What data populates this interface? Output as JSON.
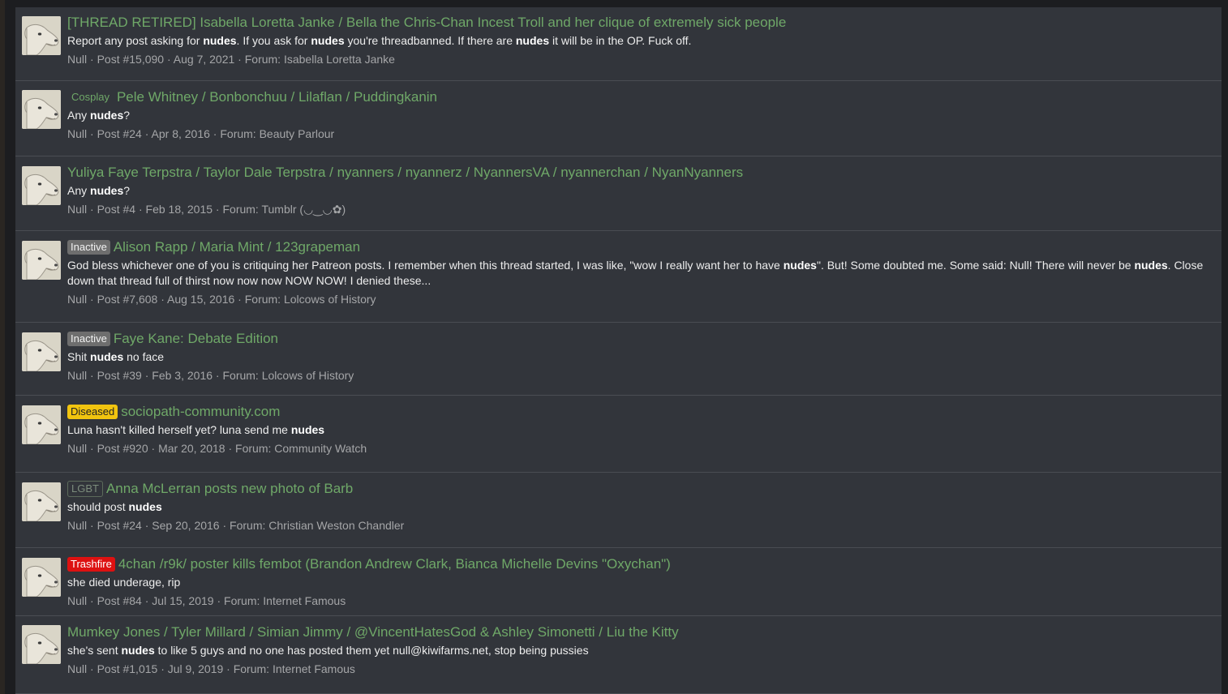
{
  "results": [
    {
      "prefix": "",
      "prefix_kind": "",
      "title": "[THREAD RETIRED] Isabella Loretta Janke / Bella the Chris-Chan Incest Troll and her clique of extremely sick people",
      "snippet": [
        "Report any post asking for ",
        "nudes",
        ". If you ask for ",
        "nudes",
        " you're threadbanned. If there are ",
        "nudes",
        " it will be in the OP. Fuck off."
      ],
      "author": "Null",
      "post": "Post #15,090",
      "date": "Aug 7, 2021",
      "forum_label": "Forum:",
      "forum": "Isabella Loretta Janke"
    },
    {
      "prefix": "Cosplay",
      "prefix_kind": "plain",
      "title": "Pele Whitney / Bonbonchuu / Lilaflan / Puddingkanin",
      "snippet": [
        "Any ",
        "nudes",
        "?"
      ],
      "author": "Null",
      "post": "Post #24",
      "date": "Apr 8, 2016",
      "forum_label": "Forum:",
      "forum": "Beauty Parlour"
    },
    {
      "prefix": "",
      "prefix_kind": "",
      "title": "Yuliya Faye Terpstra / Taylor Dale Terpstra / nyanners / nyannerz / NyannersVA / nyannerchan / NyanNyanners",
      "snippet": [
        "Any ",
        "nudes",
        "?"
      ],
      "author": "Null",
      "post": "Post #4",
      "date": "Feb 18, 2015",
      "forum_label": "Forum:",
      "forum": "Tumblr (◡‿◡✿)"
    },
    {
      "prefix": "Inactive",
      "prefix_kind": "inactive",
      "title": "Alison Rapp / Maria Mint / 123grapeman",
      "snippet": [
        "God bless whichever one of you is critiquing her Patreon posts. I remember when this thread started, I was like, \"wow I really want her to have ",
        "nudes",
        "\". But! Some doubted me. Some said: Null! There will never be ",
        "nudes",
        ". Close down that thread full of thirst now now now NOW NOW! I denied these..."
      ],
      "author": "Null",
      "post": "Post #7,608",
      "date": "Aug 15, 2016",
      "forum_label": "Forum:",
      "forum": "Lolcows of History"
    },
    {
      "prefix": "Inactive",
      "prefix_kind": "inactive",
      "title": "Faye Kane: Debate Edition",
      "snippet": [
        "Shit ",
        "nudes",
        " no face"
      ],
      "author": "Null",
      "post": "Post #39",
      "date": "Feb 3, 2016",
      "forum_label": "Forum:",
      "forum": "Lolcows of History"
    },
    {
      "prefix": "Diseased",
      "prefix_kind": "diseased",
      "title": "sociopath-community.com",
      "snippet": [
        "Luna hasn't killed herself yet? luna send me ",
        "nudes",
        ""
      ],
      "author": "Null",
      "post": "Post #920",
      "date": "Mar 20, 2018",
      "forum_label": "Forum:",
      "forum": "Community Watch"
    },
    {
      "prefix": "LGBT",
      "prefix_kind": "lgbt",
      "title": "Anna McLerran posts new photo of Barb",
      "snippet": [
        "should post ",
        "nudes",
        ""
      ],
      "author": "Null",
      "post": "Post #24",
      "date": "Sep 20, 2016",
      "forum_label": "Forum:",
      "forum": "Christian Weston Chandler"
    },
    {
      "prefix": "Trashfire",
      "prefix_kind": "trashfire",
      "title": "4chan /r9k/ poster kills fembot (Brandon Andrew Clark, Bianca Michelle Devins \"Oxychan\")",
      "snippet": [
        "she died underage, rip"
      ],
      "author": "Null",
      "post": "Post #84",
      "date": "Jul 15, 2019",
      "forum_label": "Forum:",
      "forum": "Internet Famous"
    },
    {
      "prefix": "",
      "prefix_kind": "",
      "title": "Mumkey Jones / Tyler Millard / Simian Jimmy / @VincentHatesGod & Ashley Simonetti / Liu the Kitty",
      "snippet": [
        "she's sent ",
        "nudes",
        " to like 5 guys and no one has posted them yet null@kiwifarms.net, stop being pussies"
      ],
      "author": "Null",
      "post": "Post #1,015",
      "date": "Jul 9, 2019",
      "forum_label": "Forum:",
      "forum": "Internet Famous"
    }
  ]
}
